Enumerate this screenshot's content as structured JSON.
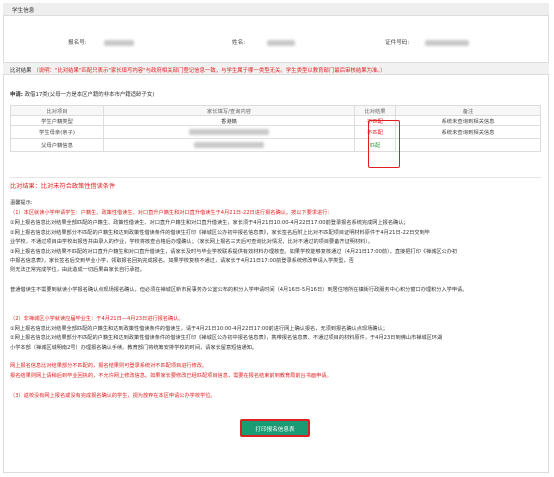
{
  "student_info": {
    "section_title": "学生信息",
    "reg_no_label": "报名号:",
    "name_label": "姓名:",
    "id_label": "证件号码:"
  },
  "compare": {
    "label": "比对结果",
    "note": "（说明：\"比对结果\"匹配只表示\"家长填写内容\"与政府相关部门登记信息一致，与学生属于哪一类型无关。学生类型以教育部门最后审核结果为准。）"
  },
  "apply": {
    "label": "申请:",
    "value": "政借17类(父母一方是本区户籍的非本市户籍适龄子女)"
  },
  "table": {
    "headers": [
      "比对项目",
      "家长填写/查询内容",
      "比对结果",
      "备注"
    ],
    "rows": [
      {
        "item": "学生户籍类型",
        "content": "香港籍",
        "result": "不匹配",
        "status": "mismatch",
        "remark": "系统未查询到相关信息"
      },
      {
        "item": "学生母亲(亲子)",
        "content": "",
        "result": "不匹配",
        "status": "mismatch",
        "remark": "系统未查询到相关信息"
      },
      {
        "item": "父母户籍信息",
        "content": "",
        "result": "匹配",
        "status": "match",
        "remark": ""
      }
    ]
  },
  "result_summary": "比对结果：比对未符合政策性借读条件",
  "body": {
    "tip": "温馨提示:",
    "p1_head": "（1）本区就读小学申请学生：户籍生、政策性借读生、对口直升户籍生和对口直升借读生于4月21日-22日进行报名确认。按以下要求进行：",
    "p1_l1": "①网上报名信息比对结果全部匹配的户籍生、政策性借读生、对口直升户籍生和对口直升借读生，家长须于4月21日10:00-4月22日17:00前登录报名系统完成网上报名确认；",
    "p1_l2": "②网上报名信息比对结果部分不匹配的户籍生和达到政策性借读条件的借读生打印《禅城区公办初中报名信息表》，家长签名后附上比对不匹配项目证明材料原件于4月21日-22日交到毕",
    "p1_l3": "业学校，不通过项目由学校出报告并由录入的作业，学校将核查合格后办理确认；（家长网上报名三天后可查询比对情况，比对不通过的项目要备齐证明材料）。",
    "p1_l4": "③网上报名信息比对结果不匹配的对口直升户籍生和对口直升借读生，请家长及时与毕业学校联系提供有效材料办理核查。如果学校能够复核通过（4月21日17:00前），直接把打印《禅城区公办初",
    "p1_l5": "中报名信息表》，家长签名后交到毕业小学，领取报名回执完成报名。如果学校复核不通过，请家长于4月21日17:00前登录系统修改申请入学类型，否",
    "p1_l6": "则无法正常完成学位，由此造成一切后果由家长自行承担。",
    "p2": "普通借读生不需要到就读小学报名确认点现场报名确认，但必须在禅城区新市民事务办公室公布的积分入学申请时间（4月16日-5月16日）到居住地所在镇街行政服务中心积分窗口办理积分入学申请。",
    "p3_head": "（2）非禅城区小学就读应届毕业生：于4月21日—4月23日进行报名确认。",
    "p3_l1": "①网上报名信息比对结果全部匹配的户籍生和达到政策性借读条件的借读生，请于4月21日10:00-4月22日17:00前进行网上确认报名，无须到报名确认点现场确认；",
    "p3_l2": "②网上报名信息比对结果部分不匹配的户籍生和达到政策性借读条件的借读生打印《禅城区公办初中报名信息表》，携带报名信息表、不通过项目的材料原件，于4月23日到佛山市禅城区环湖",
    "p3_l3": "小学本部（禅城区城明南2号）办理报名确认手续。教育部门将统筹安排学校的时间，请家长留意短信通知。",
    "p4_l1": "网上报名信息比对结果部分不匹配的，报名结果则可登录系统对不匹配项目进行修改。",
    "p4_l2": "报名结果则网上请稍后到毕业回执的，不允许网上修改信息。如果家长要修改已经匹配项目信息，需要在报名结束前到教育局前台书面申请。",
    "p5": "（3）返校没有网上报名或没有完成报名确认的学生，视为放弃在本区申请公办学校学位。"
  },
  "print_button": "打印报名信息表"
}
